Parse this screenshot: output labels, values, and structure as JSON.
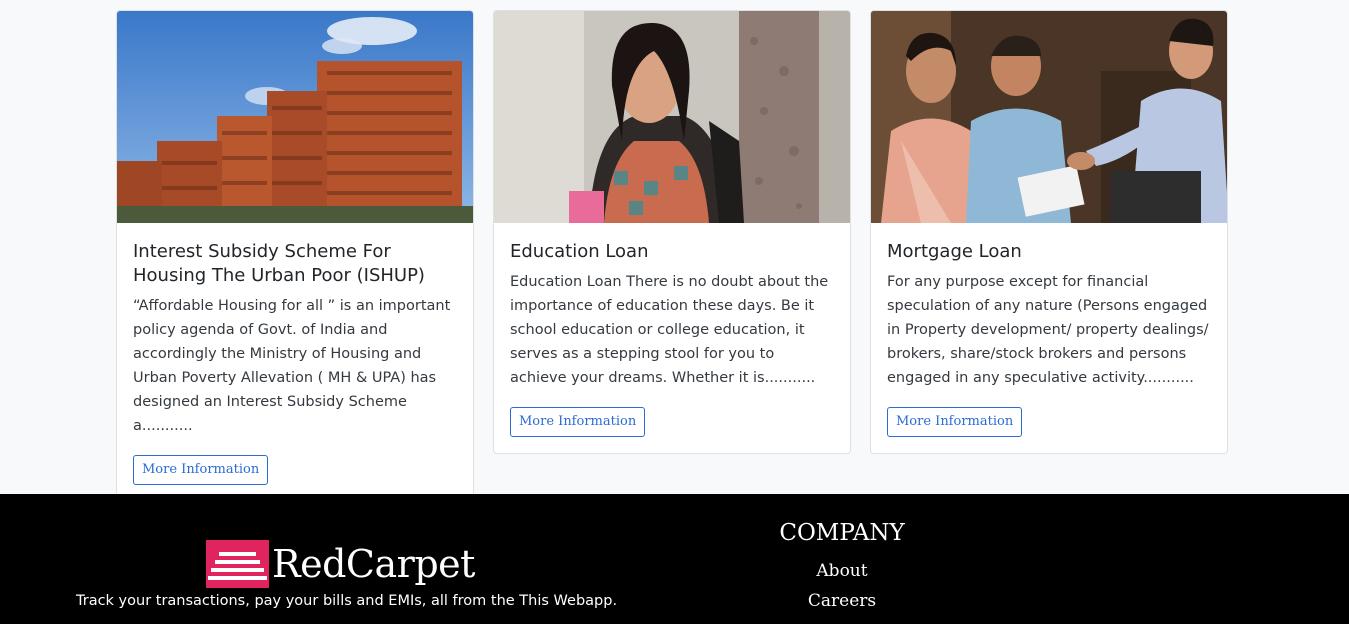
{
  "cards": [
    {
      "title": "Interest Subsidy Scheme For Housing The Urban Poor (ISHUP)",
      "text": "“Affordable Housing for all ” is an important policy agenda of Govt. of India and accordingly the Ministry of Housing and Urban Poverty Allevation ( MH & UPA) has designed an Interest Subsidy Scheme a...........",
      "button": "More Information",
      "image": "apartment-buildings-photo"
    },
    {
      "title": "Education Loan",
      "text": "Education Loan There is no doubt about the importance of education these days. Be it school education or college education, it serves as a stepping stool for you to achieve your dreams. Whether it is...........",
      "button": "More Information",
      "image": "student-photo"
    },
    {
      "title": "Mortgage Loan",
      "text": "For any purpose except for financial speculation of any nature (Persons engaged in Property development/ property dealings/ brokers, share/stock brokers and persons engaged in any speculative activity...........",
      "button": "More Information",
      "image": "handshake-photo"
    }
  ],
  "footer": {
    "brand": "RedCarpet",
    "tagline": "Track your transactions, pay your bills and EMIs, all from the This Webapp.",
    "company_title": "COMPANY",
    "links": [
      "About",
      "Careers"
    ]
  },
  "colors": {
    "accent": "#2c6bd4",
    "logo": "#e0245e",
    "footer_bg": "#000000"
  }
}
